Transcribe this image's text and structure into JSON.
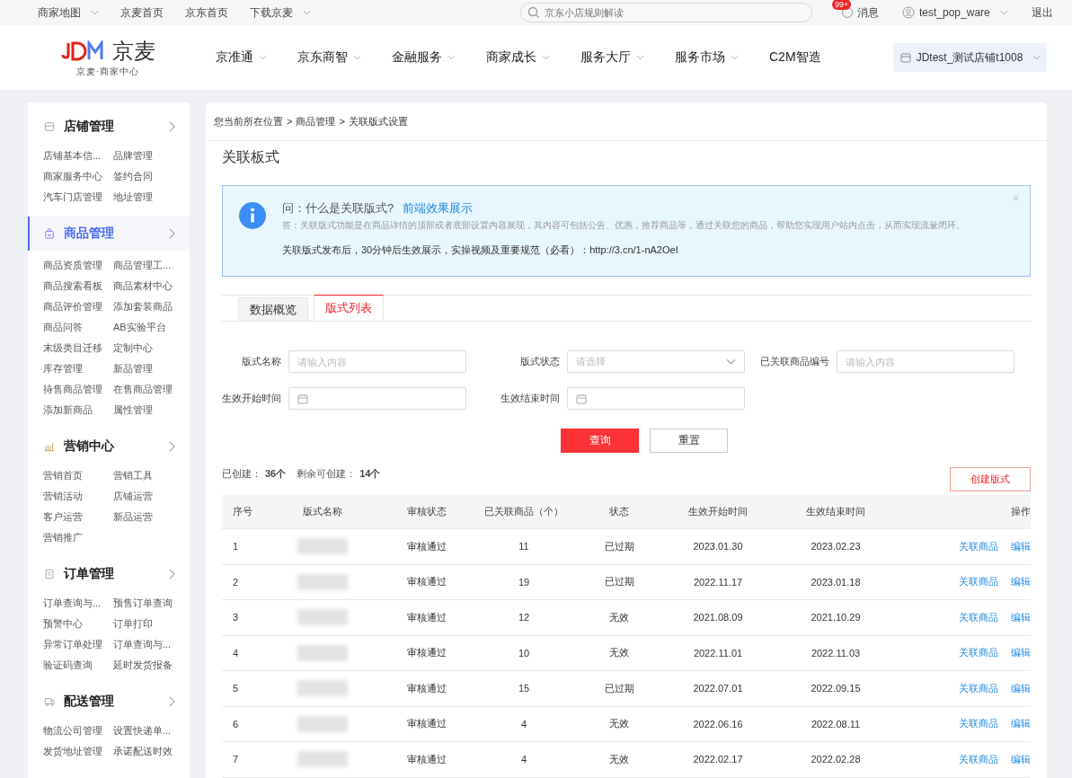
{
  "top_bar": {
    "links": [
      {
        "label": "商家地图",
        "dropdown": true
      },
      {
        "label": "京麦首页",
        "dropdown": false
      },
      {
        "label": "京东首页",
        "dropdown": false
      },
      {
        "label": "下载京麦",
        "dropdown": true
      }
    ],
    "search": {
      "placeholder": "京东小店规则解读"
    },
    "messages": {
      "badge": "99+",
      "label": "消息"
    },
    "user": {
      "name": "test_pop_ware"
    },
    "logout": "退出"
  },
  "header": {
    "logo": {
      "brand": "京麦",
      "subtitle": "京麦·商家中心"
    },
    "nav": [
      {
        "label": "京准通",
        "dropdown": true
      },
      {
        "label": "京东商智",
        "dropdown": true
      },
      {
        "label": "金融服务",
        "dropdown": true
      },
      {
        "label": "商家成长",
        "dropdown": true
      },
      {
        "label": "服务大厅",
        "dropdown": true
      },
      {
        "label": "服务市场",
        "dropdown": true
      },
      {
        "label": "C2M智造",
        "dropdown": false
      }
    ],
    "shop": "JDtest_测试店铺t1008"
  },
  "sidebar": {
    "sections": [
      {
        "kind": "shop",
        "title": "店铺管理",
        "selected": false,
        "items": [
          "店铺基本信...",
          "品牌管理",
          "商家服务中心",
          "签约合同",
          "汽车门店管理",
          "地址管理"
        ]
      },
      {
        "kind": "goods",
        "title": "商品管理",
        "selected": true,
        "items": [
          "商品资质管理",
          "商品管理工...",
          "商品搜索看板",
          "商品素材中心",
          "商品评价管理",
          "添加套装商品",
          "商品问答",
          "AB实验平台",
          "末级类目迁移",
          "定制中心",
          "库存管理",
          "新品管理",
          "待售商品管理",
          "在售商品管理",
          "添加新商品",
          "属性管理"
        ]
      },
      {
        "kind": "marketing",
        "title": "营销中心",
        "selected": false,
        "items": [
          "营销首页",
          "营销工具",
          "营销活动",
          "店铺运营",
          "客户运营",
          "新品运营",
          "营销推广"
        ]
      },
      {
        "kind": "order",
        "title": "订单管理",
        "selected": false,
        "items": [
          "订单查询与...",
          "预售订单查询",
          "预警中心",
          "订单打印",
          "异常订单处理",
          "订单查询与...",
          "验证码查询",
          "延时发货报备"
        ]
      },
      {
        "kind": "delivery",
        "title": "配送管理",
        "selected": false,
        "items": [
          "物流公司管理",
          "设置快递单...",
          "发货地址管理",
          "承诺配送时效"
        ]
      }
    ]
  },
  "breadcrumb": {
    "separator": ">",
    "items": [
      "您当前所在位置",
      "商品管理",
      "关联版式设置"
    ]
  },
  "page_title": "关联板式",
  "notice": {
    "question": "问：什么是关联版式?",
    "link": "前端效果展示",
    "answer": "答：关联版式功能是在商品详情的顶部或者底部设置内容展现，其内容可包括公告、优惠，推荐商品等，通过关联您的商品，帮助您实现用户站内点击，从而实现流量闭环。",
    "rule": "关联版式发布后，30分钟后生效展示，实操视频及重要规范（必看）：http://3.cn/1-nA2OeI"
  },
  "tabs": [
    {
      "label": "数据概览",
      "selected": false
    },
    {
      "label": "版式列表",
      "selected": true
    }
  ],
  "filters": [
    {
      "kind": "text",
      "label": "版式名称",
      "placeholder": "请输入内容"
    },
    {
      "kind": "select",
      "label": "版式状态",
      "placeholder": "请选择"
    },
    {
      "kind": "text",
      "label": "已关联商品编号",
      "placeholder": "请输入内容"
    },
    {
      "kind": "date",
      "label": "生效开始时间"
    },
    {
      "kind": "date",
      "label": "生效结束时间"
    }
  ],
  "buttons": {
    "search": "查询",
    "reset": "重置",
    "create": "创建版式"
  },
  "summary": {
    "created_label": "已创建：",
    "created": "36个",
    "remaining_label": "剩余可创建：",
    "remaining": "14个"
  },
  "table": {
    "columns": [
      "序号",
      "版式名称",
      "审核状态",
      "已关联商品（个）",
      "状态",
      "生效开始时间",
      "生效结束时间",
      "操作"
    ],
    "rows": [
      {
        "index": "1",
        "name_blurred": true,
        "review": "审核通过",
        "linked": "11",
        "status": "已过期",
        "start": "2023.01.30",
        "end": "2023.02.23",
        "actions": [
          "关联商品",
          "编辑"
        ]
      },
      {
        "index": "2",
        "name_blurred": true,
        "review": "审核通过",
        "linked": "19",
        "status": "已过期",
        "start": "2022.11.17",
        "end": "2023.01.18",
        "actions": [
          "关联商品",
          "编辑"
        ]
      },
      {
        "index": "3",
        "name_blurred": true,
        "review": "审核通过",
        "linked": "12",
        "status": "无效",
        "start": "2021.08.09",
        "end": "2021.10.29",
        "actions": [
          "关联商品",
          "编辑"
        ]
      },
      {
        "index": "4",
        "name_blurred": true,
        "review": "审核通过",
        "linked": "10",
        "status": "无效",
        "start": "2022.11.01",
        "end": "2022.11.03",
        "actions": [
          "关联商品",
          "编辑"
        ]
      },
      {
        "index": "5",
        "name_blurred": true,
        "review": "审核通过",
        "linked": "15",
        "status": "已过期",
        "start": "2022.07.01",
        "end": "2022.09.15",
        "actions": [
          "关联商品",
          "编辑"
        ]
      },
      {
        "index": "6",
        "name_blurred": true,
        "review": "审核通过",
        "linked": "4",
        "status": "无效",
        "start": "2022.06.16",
        "end": "2022.08.11",
        "actions": [
          "关联商品",
          "编辑"
        ]
      },
      {
        "index": "7",
        "name_blurred": true,
        "review": "审核通过",
        "linked": "4",
        "status": "无效",
        "start": "2022.02.17",
        "end": "2022.02.28",
        "actions": [
          "关联商品",
          "编辑"
        ]
      }
    ]
  }
}
